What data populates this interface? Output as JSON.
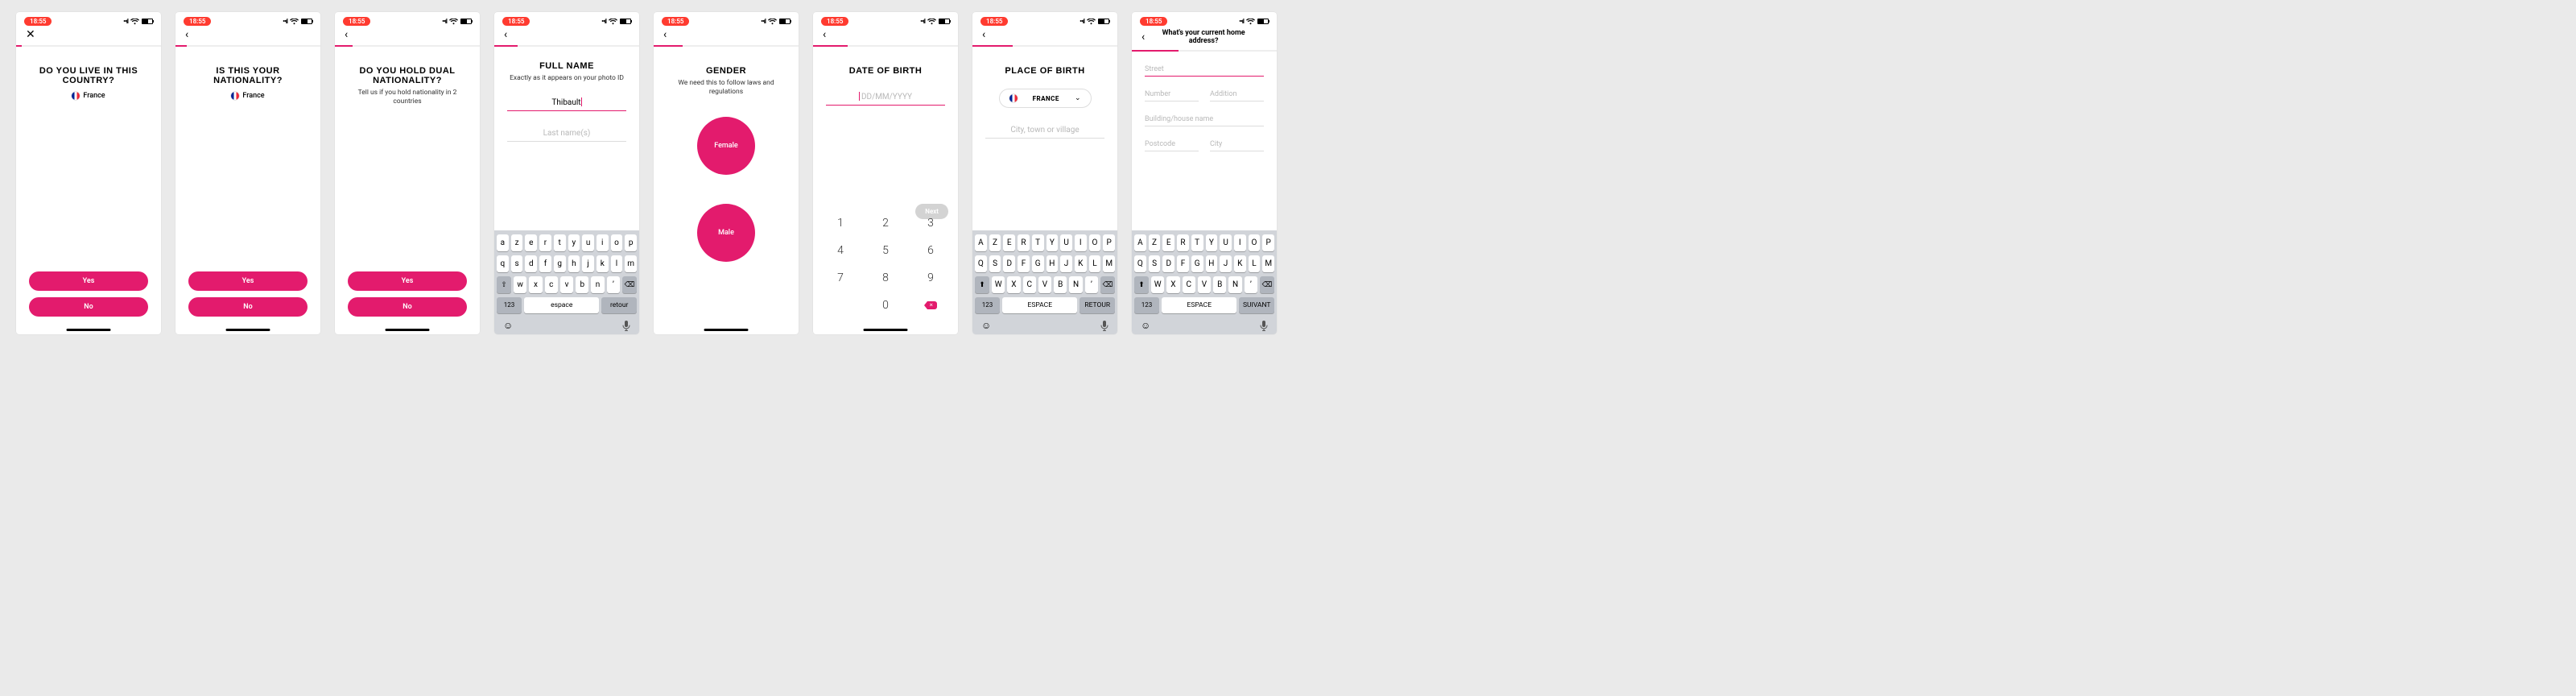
{
  "status": {
    "time": "18:55",
    "signal": "••ıl",
    "wifi": "wifi",
    "battery_pct": 60
  },
  "common": {
    "yes": "Yes",
    "no": "No",
    "next": "Next",
    "france": "France",
    "return": "retour",
    "space": "espace",
    "num_mode": "123",
    "next_key": "suivant"
  },
  "screens": {
    "s1": {
      "title": "DO YOU LIVE IN THIS COUNTRY?",
      "country": "France",
      "progress": 4
    },
    "s2": {
      "title": "IS THIS YOUR NATIONALITY?",
      "country": "France",
      "progress": 8
    },
    "s3": {
      "title": "DO YOU HOLD DUAL NATIONALITY?",
      "sub": "Tell us if you hold nationality in 2 countries",
      "progress": 12
    },
    "s4": {
      "title": "FULL NAME",
      "sub": "Exactly as it appears on your photo ID",
      "first_value": "Thibault",
      "last_placeholder": "Last name(s)",
      "progress": 16
    },
    "s5": {
      "title": "GENDER",
      "sub": "We need this to follow laws and regulations",
      "opt_female": "Female",
      "opt_male": "Male",
      "progress": 20
    },
    "s6": {
      "title": "DATE OF BIRTH",
      "placeholder": "DD/MM/YYYY",
      "progress": 24
    },
    "s7": {
      "title": "PLACE OF BIRTH",
      "country": "FRANCE",
      "city_placeholder": "City, town or village",
      "progress": 28
    },
    "s8": {
      "nav_title": "What's your current home address?",
      "fields": {
        "street": "Street",
        "number": "Number",
        "addition": "Addition",
        "building": "Building/house name",
        "postcode": "Postcode",
        "city": "City"
      },
      "progress": 32
    }
  },
  "keyboard": {
    "r1_lower": [
      "a",
      "z",
      "e",
      "r",
      "t",
      "y",
      "u",
      "i",
      "o",
      "p"
    ],
    "r2_lower": [
      "q",
      "s",
      "d",
      "f",
      "g",
      "h",
      "j",
      "k",
      "l",
      "m"
    ],
    "r3_lower": [
      "w",
      "x",
      "c",
      "v",
      "b",
      "n",
      "’"
    ],
    "r1_upper": [
      "A",
      "Z",
      "E",
      "R",
      "T",
      "Y",
      "U",
      "I",
      "O",
      "P"
    ],
    "r2_upper": [
      "Q",
      "S",
      "D",
      "F",
      "G",
      "H",
      "J",
      "K",
      "L",
      "M"
    ],
    "r3_upper": [
      "W",
      "X",
      "C",
      "V",
      "B",
      "N",
      "’"
    ]
  },
  "numpad": [
    "1",
    "2",
    "3",
    "4",
    "5",
    "6",
    "7",
    "8",
    "9",
    "",
    "0",
    "del"
  ]
}
